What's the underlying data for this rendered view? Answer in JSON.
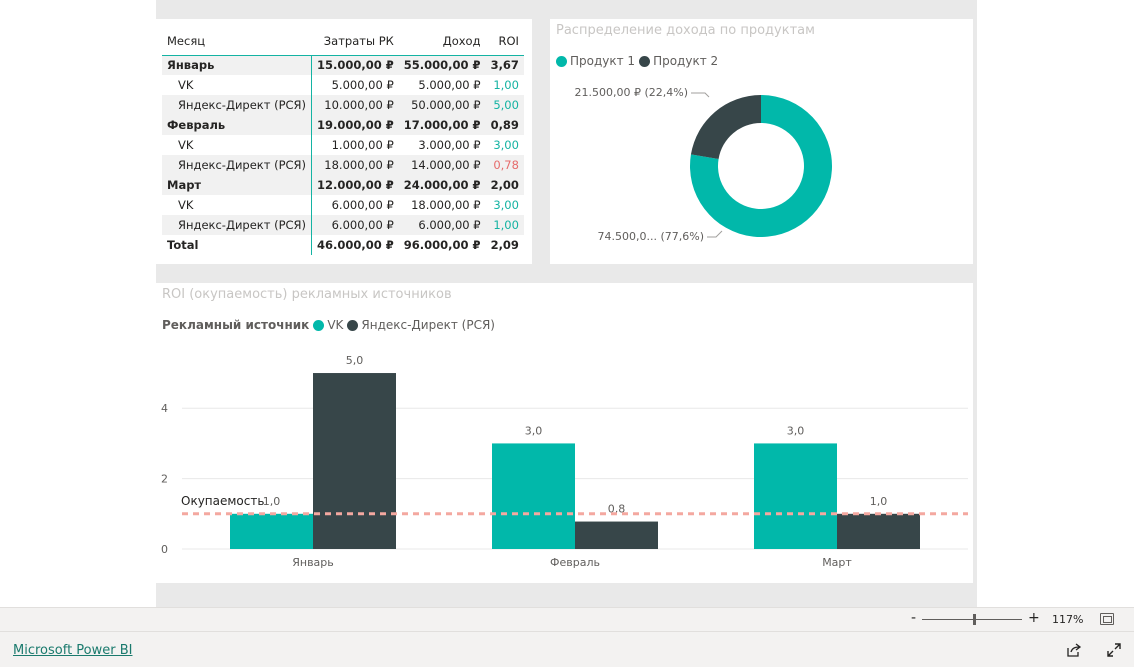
{
  "table": {
    "headers": [
      "Месяц",
      "Затраты РК",
      "Доход",
      "ROI"
    ],
    "rows": [
      {
        "kind": "group",
        "cells": [
          "Январь",
          "15.000,00 ₽",
          "55.000,00 ₽",
          "3,67"
        ],
        "roi_tone": "dark"
      },
      {
        "kind": "sub",
        "cells": [
          "VK",
          "5.000,00 ₽",
          "5.000,00 ₽",
          "1,00"
        ],
        "roi_tone": "teal"
      },
      {
        "kind": "sub",
        "cells": [
          "Яндекс-Директ (РСЯ)",
          "10.000,00 ₽",
          "50.000,00 ₽",
          "5,00"
        ],
        "roi_tone": "teal"
      },
      {
        "kind": "group",
        "cells": [
          "Февраль",
          "19.000,00 ₽",
          "17.000,00 ₽",
          "0,89"
        ],
        "roi_tone": "dark"
      },
      {
        "kind": "sub",
        "cells": [
          "VK",
          "1.000,00 ₽",
          "3.000,00 ₽",
          "3,00"
        ],
        "roi_tone": "teal"
      },
      {
        "kind": "sub",
        "cells": [
          "Яндекс-Директ (РСЯ)",
          "18.000,00 ₽",
          "14.000,00 ₽",
          "0,78"
        ],
        "roi_tone": "red"
      },
      {
        "kind": "group",
        "cells": [
          "Март",
          "12.000,00 ₽",
          "24.000,00 ₽",
          "2,00"
        ],
        "roi_tone": "dark"
      },
      {
        "kind": "sub",
        "cells": [
          "VK",
          "6.000,00 ₽",
          "18.000,00 ₽",
          "3,00"
        ],
        "roi_tone": "teal"
      },
      {
        "kind": "sub",
        "cells": [
          "Яндекс-Директ (РСЯ)",
          "6.000,00 ₽",
          "6.000,00 ₽",
          "1,00"
        ],
        "roi_tone": "teal"
      },
      {
        "kind": "total",
        "cells": [
          "Total",
          "46.000,00 ₽",
          "96.000,00 ₽",
          "2,09"
        ],
        "roi_tone": "dark"
      }
    ]
  },
  "donut": {
    "title": "Распределение дохода по продуктам",
    "legend": [
      "Продукт 1",
      "Продукт 2"
    ]
  },
  "bar": {
    "title": "ROI (окупаемость) рекламных источников",
    "legend_title": "Рекламный источник",
    "legend": [
      "VK",
      "Яндекс-Директ (РСЯ)"
    ],
    "reference_label": "Окупаемость"
  },
  "colors": {
    "teal": "#01b8aa",
    "dark": "#374649",
    "red": "#e66c6c",
    "reference": "#f4a8a0"
  },
  "chart_data": [
    {
      "type": "pie",
      "title": "Распределение дохода по продуктам",
      "donut": true,
      "legend_position": "top-left",
      "slices": [
        {
          "name": "Продукт 1",
          "value": 74500,
          "label": "74.500,0... (77,6%)",
          "color": "#01b8aa"
        },
        {
          "name": "Продукт 2",
          "value": 21500,
          "label": "21.500,00 ₽ (22,4%)",
          "color": "#374649"
        }
      ]
    },
    {
      "type": "bar",
      "title": "ROI (окупаемость) рекламных источников",
      "categories": [
        "Январь",
        "Февраль",
        "Март"
      ],
      "series": [
        {
          "name": "VK",
          "values": [
            1.0,
            3.0,
            3.0
          ],
          "labels": [
            "1,0",
            "3,0",
            "3,0"
          ],
          "color": "#01b8aa"
        },
        {
          "name": "Яндекс-Директ (РСЯ)",
          "values": [
            5.0,
            0.78,
            1.0
          ],
          "labels": [
            "5,0",
            "0,8",
            "1,0"
          ],
          "color": "#374649"
        }
      ],
      "yticks": [
        0,
        2,
        4
      ],
      "ylim": [
        0,
        5.2
      ],
      "reference_line": {
        "value": 1,
        "label": "Окупаемость"
      },
      "grid": true,
      "legend_position": "top-left"
    }
  ],
  "footer": {
    "zoom_minus": "-",
    "zoom_plus": "+",
    "zoom_level": "117%",
    "zoom_fraction": 0.52,
    "brand_link": "Microsoft Power BI"
  }
}
